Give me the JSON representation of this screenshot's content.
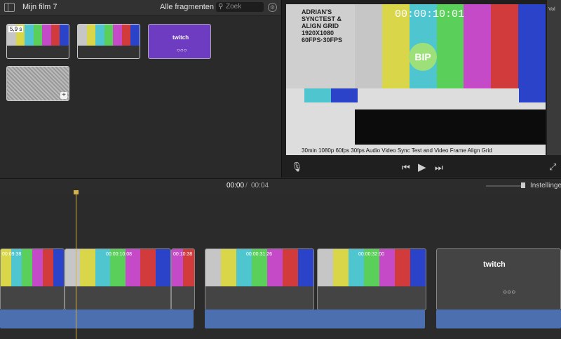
{
  "topbar": {
    "project_title": "Mijn film 7",
    "filter_label": "Alle fragmenten ⌃",
    "search_placeholder": "Zoek"
  },
  "browser": {
    "thumbnails": [
      {
        "kind": "bars",
        "badge": "5,9 s"
      },
      {
        "kind": "bars",
        "badge": ""
      },
      {
        "kind": "twitch",
        "badge": ""
      },
      {
        "kind": "noise",
        "badge": ""
      }
    ]
  },
  "viewer": {
    "timecode": "00:00:10:01",
    "logo_text": "ADRIAN'S SYNCTEST & ALIGN GRID 1920X1080 60FPS·30FPS",
    "bip_label": "BIP",
    "caption": "30min 1080p 60fps 30fps Audio Video Sync Test and Video Frame Align Grid",
    "right_strip_label": "Vol"
  },
  "timeline_header": {
    "current_time": "00:00",
    "separator": "/",
    "total_time": "00:04",
    "settings_label": "Instellingen"
  },
  "timeline": {
    "clips": [
      {
        "timecode": "00:09:38"
      },
      {
        "timecode": "00:00:10:08"
      },
      {
        "timecode": "00:10:38"
      },
      {
        "timecode": "00:00:31:26"
      },
      {
        "timecode": "00:00:32:00"
      },
      {
        "timecode": "twitch"
      }
    ]
  },
  "colors": {
    "bars": [
      "#c6c6c6",
      "#d9d64a",
      "#4fc5cf",
      "#5ad05a",
      "#c54ac7",
      "#d23b3b",
      "#2b43c8"
    ],
    "accent_playhead": "#d4b24a",
    "audio": "#4c6fb0"
  }
}
